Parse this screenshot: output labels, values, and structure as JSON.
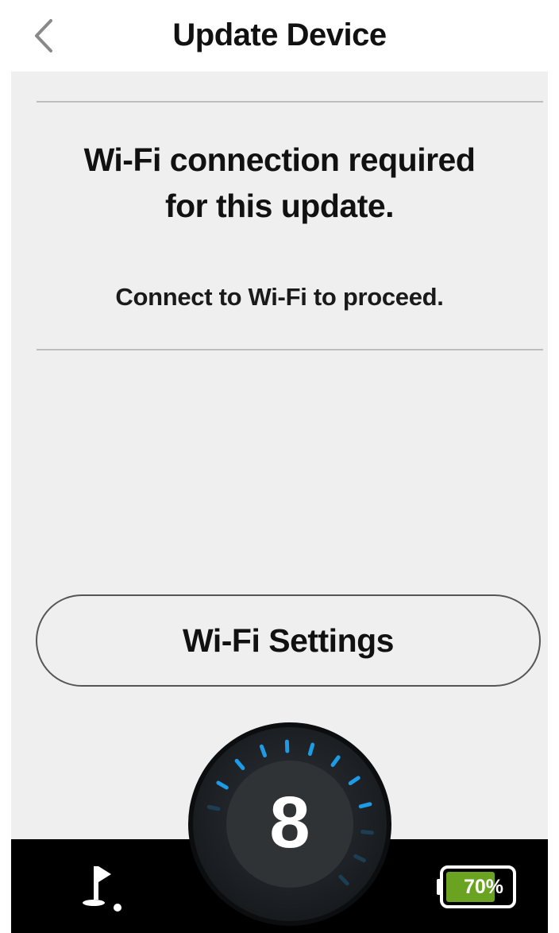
{
  "header": {
    "title": "Update Device",
    "back_icon": "chevron-left-icon"
  },
  "message": {
    "headline_line1": "Wi-Fi connection required",
    "headline_line2": "for this update.",
    "subtext": "Connect to Wi-Fi to proceed."
  },
  "actions": {
    "wifi_settings_label": "Wi-Fi Settings"
  },
  "device_status": {
    "dial_value": "8",
    "flag_icon": "golf-flag-icon",
    "battery_label": "70%",
    "battery_level": 0.7,
    "battery_color": "#6aa321",
    "accent_color": "#1e9be6"
  }
}
